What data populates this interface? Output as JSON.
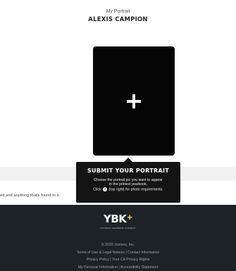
{
  "header": {
    "subtitle": "My Portrait",
    "name": "ALEXIS CAMPION"
  },
  "portrait": {
    "icon": "plus-icon"
  },
  "info_text": "ed and anything that's found to b",
  "tooltip": {
    "title": "SUBMIT YOUR PORTRAIT",
    "line1": "Choose the portrait pic you want to appear",
    "line2": "in the printed yearbook.",
    "line3_before": "Click",
    "line3_icon": "info-icon",
    "line3_after": "(top right) for photo requirements."
  },
  "footer": {
    "logo_text": "YBK",
    "logo_plus": "+",
    "logo_tagline": "JOSTENS YEARBOOK CONNECT",
    "copyright": "© 2020 Jostens, Inc.",
    "terms": "Terms of Use & Legal Notices",
    "contact": "Contact Information",
    "privacy": "Privacy Policy",
    "ca_privacy": "Your CA Privacy Rights",
    "personal_info": "My Personal Information",
    "accessibility": "Accessibility Statement",
    "separator": " | "
  },
  "colors": {
    "footer_bg": "#1d2226",
    "tooltip_bg": "#141414",
    "logo_accent": "#ffcc33"
  }
}
